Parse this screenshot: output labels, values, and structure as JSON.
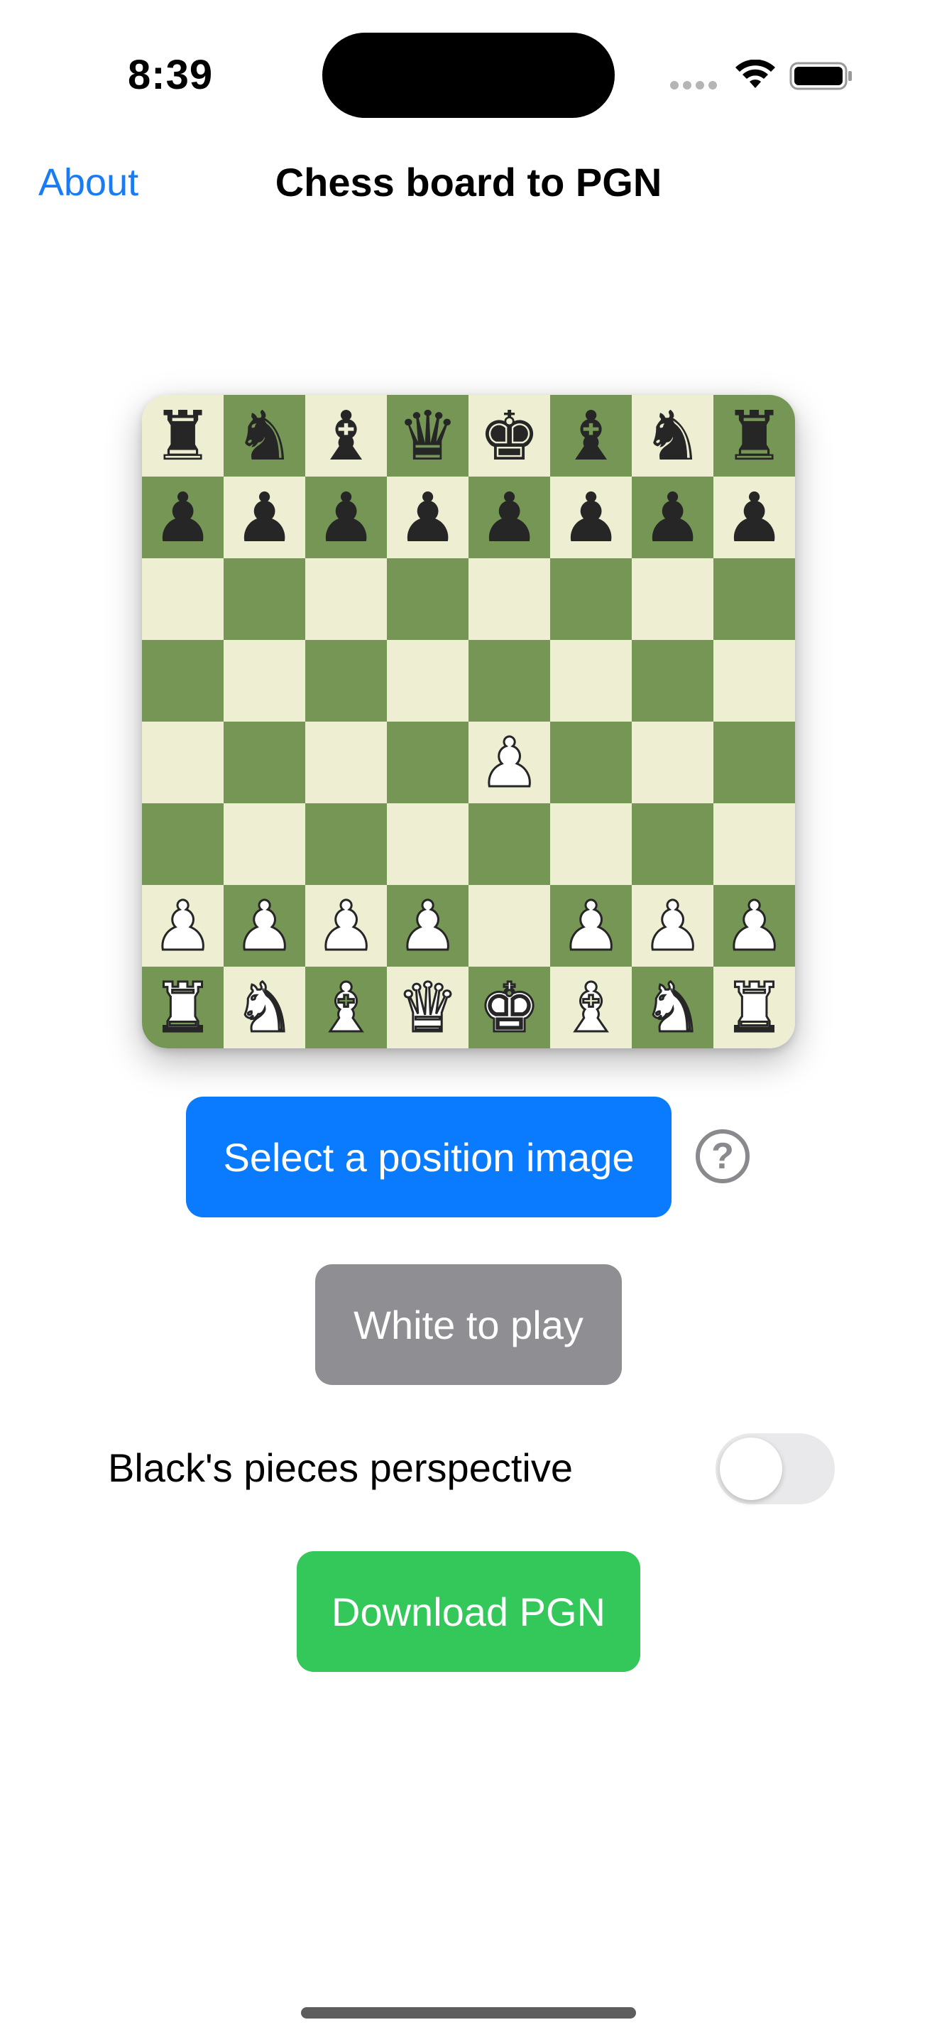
{
  "status_bar": {
    "time": "8:39"
  },
  "nav": {
    "back_label": "About",
    "title": "Chess board to PGN"
  },
  "board": {
    "fen_rows": [
      [
        "r",
        "n",
        "b",
        "q",
        "k",
        "b",
        "n",
        "r"
      ],
      [
        "p",
        "p",
        "p",
        "p",
        "p",
        "p",
        "p",
        "p"
      ],
      [
        "",
        "",
        "",
        "",
        "",
        "",
        "",
        ""
      ],
      [
        "",
        "",
        "",
        "",
        "",
        "",
        "",
        ""
      ],
      [
        "",
        "",
        "",
        "",
        "P",
        "",
        "",
        ""
      ],
      [
        "",
        "",
        "",
        "",
        "",
        "",
        "",
        ""
      ],
      [
        "P",
        "P",
        "P",
        "P",
        "",
        "P",
        "P",
        "P"
      ],
      [
        "R",
        "N",
        "B",
        "Q",
        "K",
        "B",
        "N",
        "R"
      ]
    ],
    "light_color": "#eeeed2",
    "dark_color": "#769656"
  },
  "actions": {
    "select_image_label": "Select a position image",
    "help_icon": "question-circle-icon",
    "turn_label": "White to play",
    "perspective_label": "Black's pieces perspective",
    "perspective_on": false,
    "download_label": "Download PGN"
  },
  "colors": {
    "accent": "#0a7bff",
    "turn_button": "#8e8e93",
    "download_button": "#34c759",
    "link": "#1a7cf5"
  }
}
